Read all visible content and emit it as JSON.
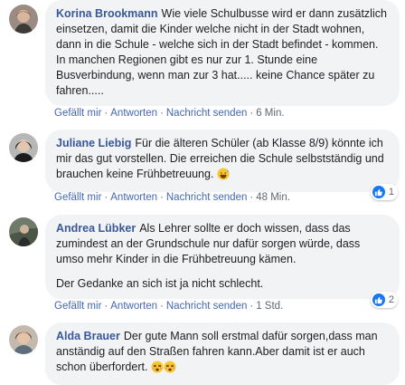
{
  "actions": {
    "like": "Gefällt mir",
    "reply": "Antworten",
    "message": "Nachricht senden",
    "separator": "·"
  },
  "comments": [
    {
      "author": "Korina Brookmann",
      "text": "Wie viele Schulbusse wird er dann zusätzlich einsetzen, damit die Kinder welche nicht in der Stadt wohnen, dann in die Schule - welche sich in der Stadt befindet - kommen. In manchen Regionen gibt es nur zur 1. Stunde eine Busverbindung, wenn man zur 3 hat..... keine Chance später zu fahren.....",
      "time": "6 Min."
    },
    {
      "author": "Juliane Liebig",
      "text": "Für die älteren Schüler (ab Klasse 8/9) könnte ich mir das gut vorstellen. Die erreichen die Schule selbstständig und brauchen keine Frühbetreuung.",
      "emoji": "grinning-sweat",
      "time": "48 Min.",
      "likes": "1"
    },
    {
      "author": "Andrea Lübker",
      "text": "Als Lehrer sollte er doch wissen, dass das zumindest an der Grundschule nur dafür sorgen würde, dass umso mehr Kinder in die Frühbetreuung kämen.",
      "text2": "Der Gedanke an sich ist ja nicht schlecht.",
      "time": "1 Std.",
      "likes": "2"
    },
    {
      "author": "Alda Brauer",
      "text": "Der gute Mann soll erstmal dafür sorgen,dass man anständig auf den Straßen fahren kann.Aber damit ist er auch schon überfordert.",
      "emoji": "dizzy-face x2"
    }
  ],
  "colors": {
    "name": "#385898",
    "link": "#4267b2",
    "bubble": "#f2f3f5",
    "like": "#1877f2"
  }
}
